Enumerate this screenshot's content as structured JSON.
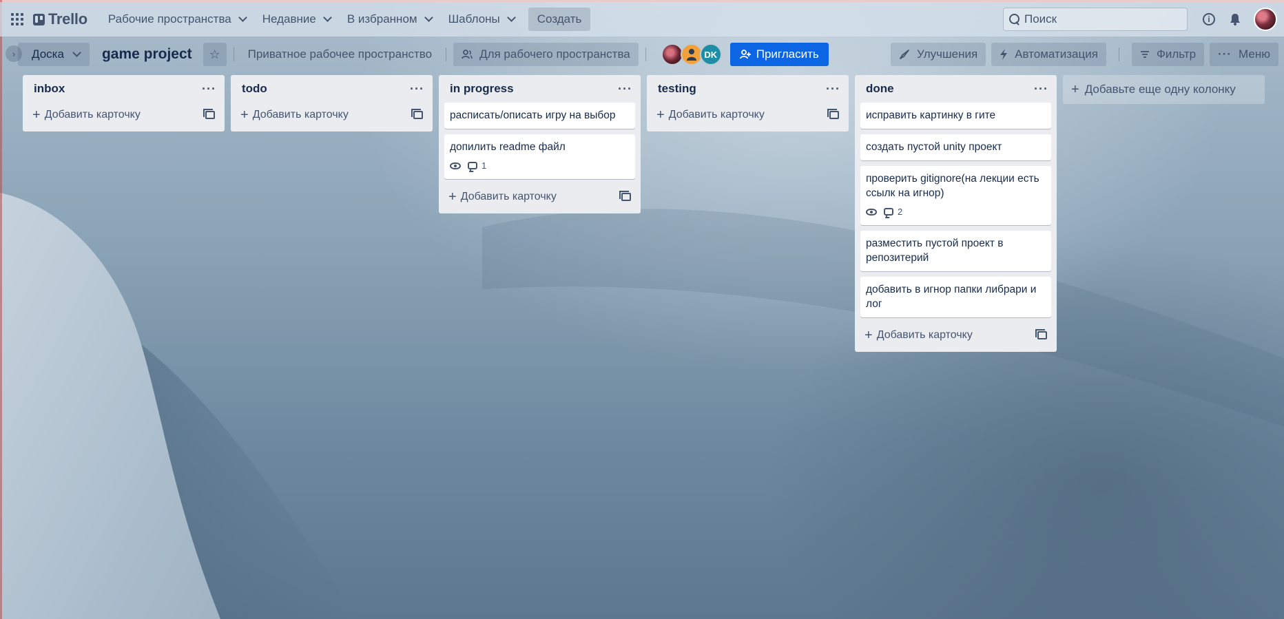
{
  "topnav": {
    "logo": "Trello",
    "menus": [
      "Рабочие пространства",
      "Недавние",
      "В избранном",
      "Шаблоны"
    ],
    "create": "Создать",
    "search_placeholder": "Поиск"
  },
  "board": {
    "view": "Доска",
    "title": "game project",
    "visibility": "Приватное рабочее пространство",
    "workspace_btn": "Для рабочего пространства",
    "members": [
      "",
      "",
      "DK"
    ],
    "invite": "Пригласить",
    "powerups": "Улучшения",
    "automation": "Автоматизация",
    "filter": "Фильтр",
    "menu": "Меню"
  },
  "lists": [
    {
      "title": "inbox",
      "cards": []
    },
    {
      "title": "todo",
      "cards": []
    },
    {
      "title": "in progress",
      "cards": [
        {
          "text": "расписать/описать игру на выбор"
        },
        {
          "text": "допилить readme файл",
          "comments": "1"
        }
      ]
    },
    {
      "title": "testing",
      "cards": []
    },
    {
      "title": "done",
      "cards": [
        {
          "text": "исправить картинку в гите"
        },
        {
          "text": "создать пустой unity проект"
        },
        {
          "text": "проверить gitignore(на лекции есть ссылк на игнор)",
          "comments": "2"
        },
        {
          "text": "разместить пустой проект в репозитерий"
        },
        {
          "text": "добавить в игнор папки либрари и лог"
        }
      ]
    }
  ],
  "add_card": "Добавить карточку",
  "add_list": "Добавьте еще одну колонку",
  "colors": {
    "accent": "#0c66e4",
    "list_bg": "#ebecf0"
  }
}
